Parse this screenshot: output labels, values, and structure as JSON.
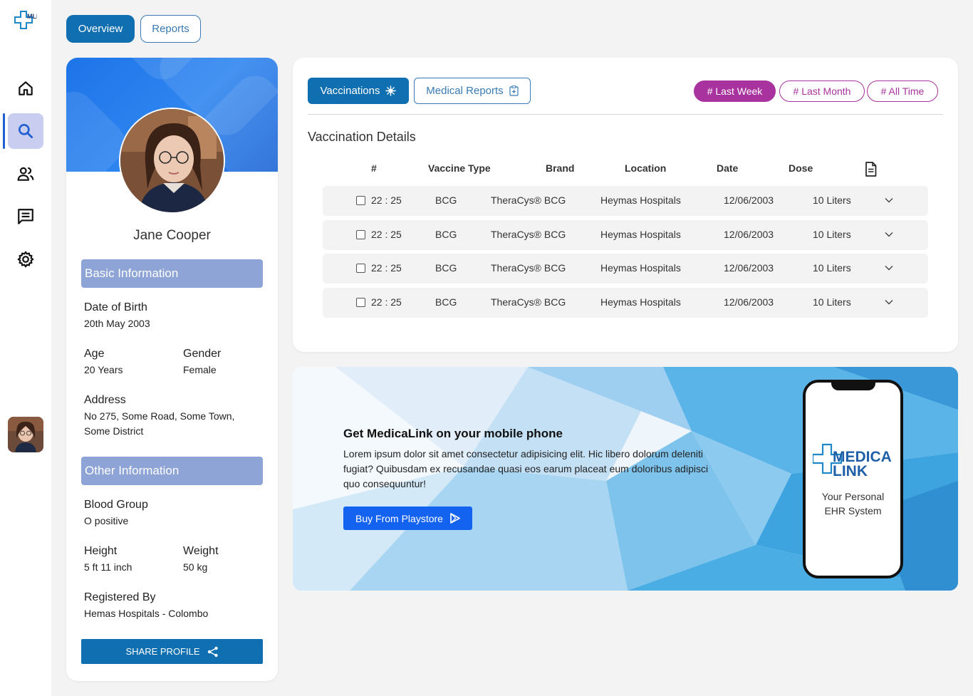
{
  "app": {
    "logo_letters": "MLI"
  },
  "sidebar": {
    "items": [
      {
        "name": "home",
        "icon": "home-icon"
      },
      {
        "name": "search",
        "icon": "search-icon",
        "active": true
      },
      {
        "name": "users",
        "icon": "users-icon"
      },
      {
        "name": "messages",
        "icon": "message-icon"
      },
      {
        "name": "settings",
        "icon": "gear-icon"
      }
    ]
  },
  "top_tabs": {
    "overview": "Overview",
    "reports": "Reports"
  },
  "profile": {
    "name": "Jane Cooper",
    "basic_heading": "Basic Information",
    "dob_label": "Date of Birth",
    "dob_value": "20th May 2003",
    "age_label": "Age",
    "age_value": "20 Years",
    "gender_label": "Gender",
    "gender_value": "Female",
    "address_label": "Address",
    "address_line1": "No 275, Some Road, Some Town,",
    "address_line2": "Some District",
    "other_heading": "Other Information",
    "blood_label": "Blood Group",
    "blood_value": "O positive",
    "height_label": "Height",
    "height_value": "5 ft 11 inch",
    "weight_label": "Weight",
    "weight_value": "50 kg",
    "registered_label": "Registered By",
    "registered_value": "Hemas Hospitals - Colombo",
    "share_label": "SHARE PROFILE"
  },
  "vaccinations": {
    "tab_vacc": "Vaccinations",
    "tab_med": "Medical Reports",
    "filters": [
      "# Last Week",
      "# Last Month",
      "# All Time"
    ],
    "title": "Vaccination Details",
    "headers": [
      "#",
      "Vaccine Type",
      "Brand",
      "Location",
      "Date",
      "Dose"
    ],
    "rows": [
      {
        "time": "22 : 25",
        "type": "BCG",
        "brand": "TheraCys® BCG",
        "location": "Heymas Hospitals",
        "date": "12/06/2003",
        "dose": "10 Liters"
      },
      {
        "time": "22 : 25",
        "type": "BCG",
        "brand": "TheraCys® BCG",
        "location": "Heymas Hospitals",
        "date": "12/06/2003",
        "dose": "10 Liters"
      },
      {
        "time": "22 : 25",
        "type": "BCG",
        "brand": "TheraCys® BCG",
        "location": "Heymas Hospitals",
        "date": "12/06/2003",
        "dose": "10 Liters"
      },
      {
        "time": "22 : 25",
        "type": "BCG",
        "brand": "TheraCys® BCG",
        "location": "Heymas Hospitals",
        "date": "12/06/2003",
        "dose": "10 Liters"
      }
    ]
  },
  "promo": {
    "title": "Get MedicaLink on your mobile phone",
    "text": "Lorem ipsum dolor sit amet consectetur adipisicing elit. Hic libero dolorum deleniti fugiat? Quibusdam ex recusandae quasi eos earum placeat eum doloribus adipisci quo consequuntur!",
    "button": "Buy From Playstore",
    "phone_logo_line1": "MEDICA",
    "phone_logo_line2": "LINK",
    "phone_tagline_1": "Your Personal",
    "phone_tagline_2": "EHR System"
  },
  "colors": {
    "primary": "#0f6fb0",
    "accent": "#a8329e",
    "section": "#8ea3d6",
    "play": "#1463f0"
  }
}
